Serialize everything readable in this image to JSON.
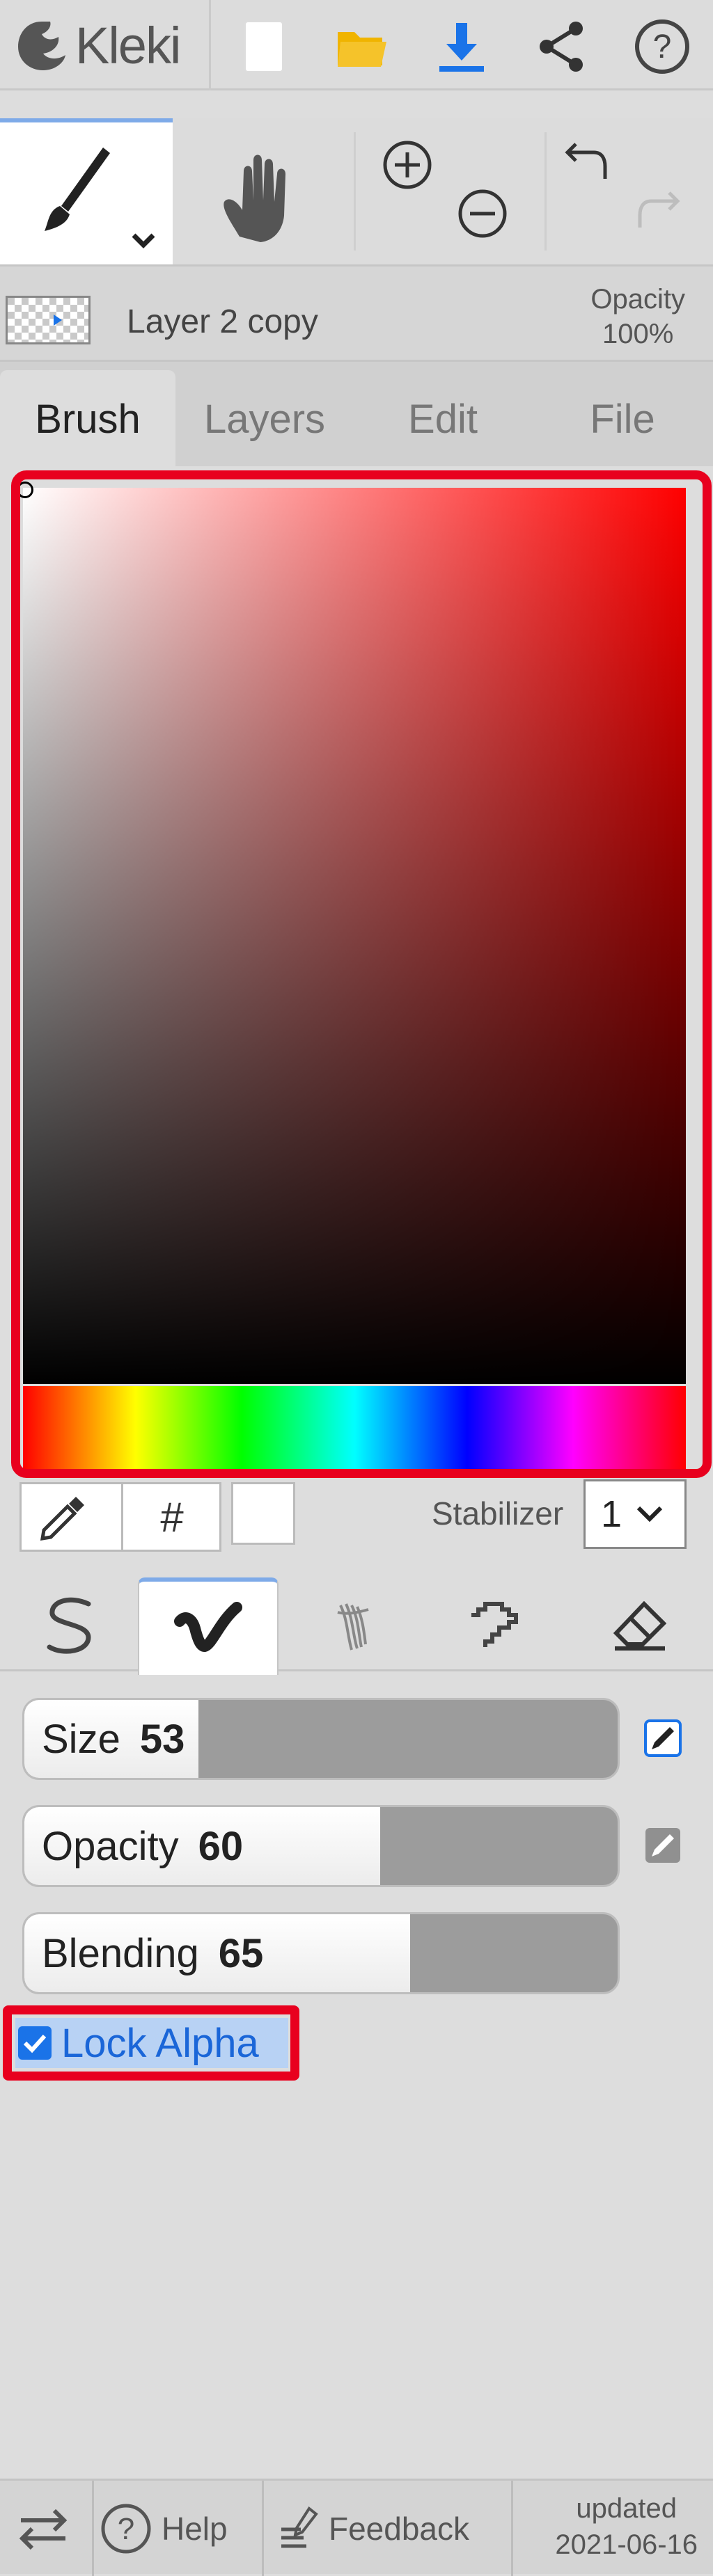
{
  "app": {
    "name": "Kleki"
  },
  "toolbar": {
    "icons": [
      "kleki-logo-icon",
      "new-file-icon",
      "open-folder-icon",
      "download-icon",
      "share-icon",
      "help-icon"
    ],
    "colors": {
      "folder": "#f0b400",
      "download": "#1a73e8"
    }
  },
  "tools": {
    "items": [
      "brush-tool",
      "hand-tool",
      "zoom-in",
      "zoom-out",
      "undo",
      "redo"
    ]
  },
  "layer": {
    "name": "Layer 2 copy",
    "opacity_label": "Opacity",
    "opacity_value": "100%"
  },
  "tabs": [
    {
      "label": "Brush",
      "active": true
    },
    {
      "label": "Layers",
      "active": false
    },
    {
      "label": "Edit",
      "active": false
    },
    {
      "label": "File",
      "active": false
    }
  ],
  "color_picker": {
    "hue_color": "#ff0000",
    "current_color": "#ffffff",
    "hex_label": "#",
    "stabilizer_label": "Stabilizer",
    "stabilizer_value": "1"
  },
  "brush_types": {
    "items": [
      "pen-brush-icon",
      "blend-brush-icon",
      "sketchy-brush-icon",
      "pixel-brush-icon",
      "eraser-icon"
    ],
    "active_index": 1
  },
  "sliders": [
    {
      "label": "Size",
      "value": "53",
      "fraction": 0.294
    },
    {
      "label": "Opacity",
      "value": "60",
      "fraction": 0.6
    },
    {
      "label": "Blending",
      "value": "65",
      "fraction": 0.65
    }
  ],
  "lock_alpha": {
    "label": "Lock Alpha",
    "checked": true
  },
  "footer": {
    "help": "Help",
    "feedback": "Feedback",
    "updated_label": "updated",
    "updated_date": "2021-06-16"
  },
  "highlight_color": "#e8001e"
}
